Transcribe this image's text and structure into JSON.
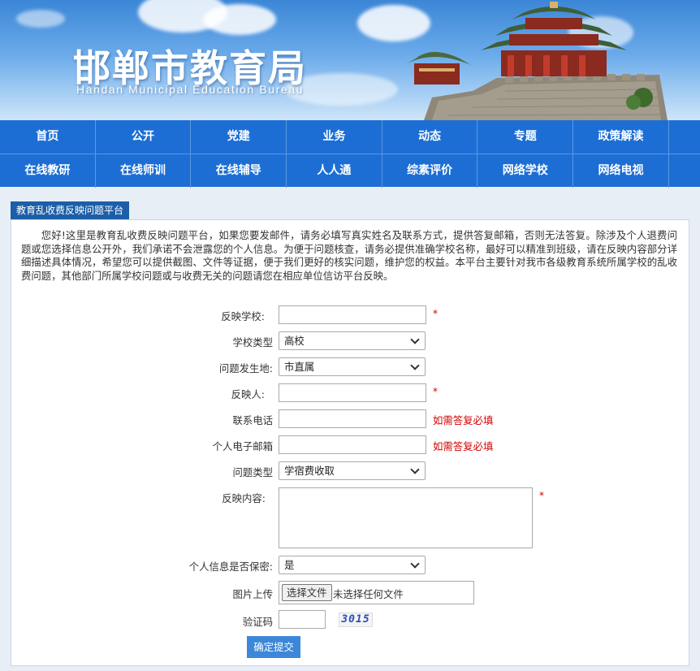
{
  "header": {
    "title_cn": "邯郸市教育局",
    "title_en": "Handan Municipal Education Bureau"
  },
  "nav": {
    "row1": [
      "首页",
      "公开",
      "党建",
      "业务",
      "动态",
      "专题",
      "政策解读"
    ],
    "row2": [
      "在线教研",
      "在线师训",
      "在线辅导",
      "人人通",
      "综素评价",
      "网络学校",
      "网络电视"
    ]
  },
  "panel": {
    "tab_title": "教育乱收费反映问题平台",
    "intro": "您好!这里是教育乱收费反映问题平台，如果您要发邮件，请务必填写真实姓名及联系方式，提供答复邮箱，否则无法答复。除涉及个人退费问题或您选择信息公开外，我们承诺不会泄露您的个人信息。为便于问题核查，请务必提供准确学校名称，最好可以精准到班级，请在反映内容部分详细描述具体情况，希望您可以提供截图、文件等证据，便于我们更好的核实问题，维护您的权益。本平台主要针对我市各级教育系统所属学校的乱收费问题，其他部门所属学校问题或与收费无关的问题请您在相应单位信访平台反映。"
  },
  "form": {
    "school_label": "反映学校:",
    "school_type_label": "学校类型",
    "school_type_value": "高校",
    "location_label": "问题发生地:",
    "location_value": "市直属",
    "reporter_label": "反映人:",
    "phone_label": "联系电话",
    "email_label": "个人电子邮箱",
    "issue_type_label": "问题类型",
    "issue_type_value": "学宿费收取",
    "content_label": "反映内容:",
    "privacy_label": "个人信息是否保密:",
    "privacy_value": "是",
    "upload_label": "图片上传",
    "upload_button": "选择文件",
    "upload_status": "未选择任何文件",
    "captcha_label": "验证码",
    "captcha_text": "3015",
    "required_mark": "*",
    "reply_required_hint": "如需答复必填",
    "submit_label": "确定提交"
  },
  "colors": {
    "nav_bg": "#1c6ed4",
    "tab_bg": "#1c5fa8",
    "required": "#d40000",
    "submit_bg": "#3d87d9"
  }
}
